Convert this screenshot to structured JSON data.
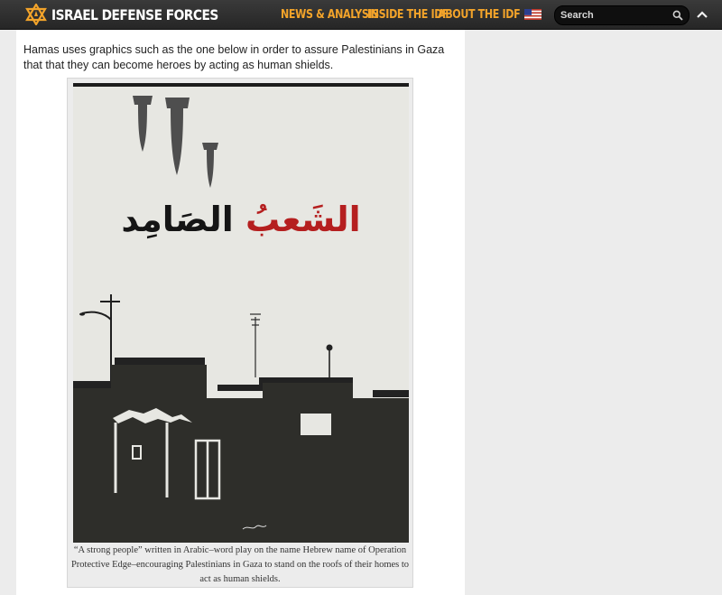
{
  "header": {
    "logo_text": "ISRAEL DEFENSE FORCES",
    "nav": [
      "NEWS & ANALYSIS",
      "INSIDE THE IDF",
      "ABOUT THE IDF"
    ],
    "flag_icon": "us-flag-icon",
    "search_placeholder": "Search",
    "colors": {
      "bar": "#2b2b2b",
      "nav": "#f2a32a",
      "logo_star": "#f2a32a"
    }
  },
  "article": {
    "intro": "Hamas uses graphics such as the one below in order to assure Palestinians in Gaza that that they can become heroes by acting as human shields.",
    "poster_title": {
      "word_red": "الشَعبُ",
      "word_black": "الصَامِد"
    },
    "caption": "“A strong people” written in Arabic–word play on the name Hebrew name of Operation Protective Edge–encouraging Palestinians in Gaza to stand on the roofs of their homes to act as human shields."
  }
}
